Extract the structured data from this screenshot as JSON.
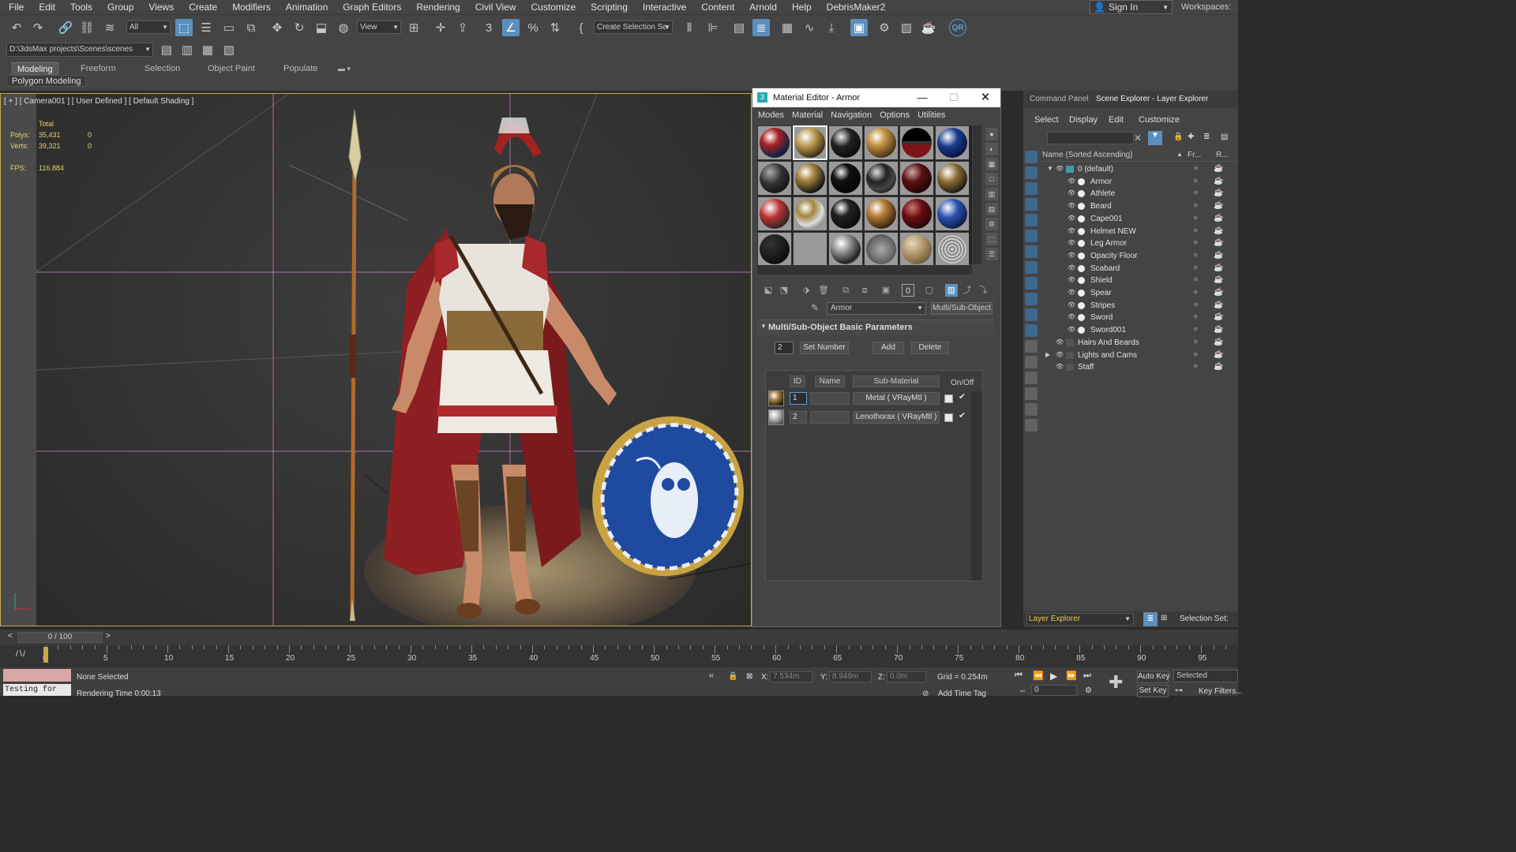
{
  "menu": [
    "File",
    "Edit",
    "Tools",
    "Group",
    "Views",
    "Create",
    "Modifiers",
    "Animation",
    "Graph Editors",
    "Rendering",
    "Civil View",
    "Customize",
    "Scripting",
    "Interactive",
    "Content",
    "Arnold",
    "Help",
    "DebrisMaker2"
  ],
  "signin": {
    "label": "Sign In"
  },
  "workspaces": {
    "label": "Workspaces:"
  },
  "toolbar": {
    "filter_dd": "All",
    "view_dd": "View",
    "selection_set_dd": "Create Selection Se",
    "snap_3": "3",
    "qr": "QR"
  },
  "project_path": "D:\\3dsMax projects\\Scenes\\scenes",
  "ribbon": {
    "tabs": [
      "Modeling",
      "Freeform",
      "Selection",
      "Object Paint",
      "Populate"
    ],
    "active": "Modeling",
    "sub": "Polygon Modeling"
  },
  "viewport": {
    "label": "[ + ] [ Camera001 ] [ User Defined ] [ Default Shading ]",
    "stats": {
      "total": "Total",
      "polys_label": "Polys:",
      "polys": "35,431",
      "polys_sel": "0",
      "verts_label": "Verts:",
      "verts": "39,321",
      "verts_sel": "0",
      "fps_label": "FPS:",
      "fps": "116.884"
    }
  },
  "material_editor": {
    "title": "Material Editor - Armor",
    "menu": [
      "Modes",
      "Material",
      "Navigation",
      "Options",
      "Utilities"
    ],
    "material_name": "Armor",
    "material_type": "Multi/Sub-Object",
    "rollout": "Multi/Sub-Object Basic Parameters",
    "set_number_value": "2",
    "set_number": "Set Number",
    "add": "Add",
    "delete": "Delete",
    "headers": {
      "id": "ID",
      "name": "Name",
      "sub": "Sub-Material",
      "onoff": "On/Off"
    },
    "rows": [
      {
        "id": "1",
        "sub": "Metal ( VRayMtl )"
      },
      {
        "id": "2",
        "sub": "Lenothorax ( VRayMtl )"
      }
    ]
  },
  "right_panel": {
    "tabs": [
      "Command Panel",
      "Scene Explorer - Layer Explorer"
    ],
    "menu": [
      "Select",
      "Display",
      "Edit",
      "Customize"
    ],
    "header": {
      "name": "Name (Sorted Ascending)",
      "fr": "Fr...",
      "r": "R..."
    },
    "root": "0 (default)",
    "children": [
      "Armor",
      "Athlete",
      "Beard",
      "Cape001",
      "Helmet NEW",
      "Leg Armor",
      "Opacity Floor",
      "Scabard",
      "Shield",
      "Spear",
      "Stripes",
      "Sword",
      "Sword001"
    ],
    "layers": [
      "Hairs And Beards",
      "Lights and Cams",
      "Staff"
    ],
    "explorer_dd": "Layer Explorer",
    "selection_set": "Selection Set:"
  },
  "timeline": {
    "frame": "0 / 100",
    "ticks": [
      "0",
      "5",
      "10",
      "15",
      "20",
      "25",
      "30",
      "35",
      "40",
      "45",
      "50",
      "55",
      "60",
      "65",
      "70",
      "75",
      "80",
      "85",
      "90",
      "95"
    ]
  },
  "status": {
    "maxscript": "Testing for ",
    "selected": "None Selected",
    "render_time": "Rendering Time 0:00:13",
    "x_label": "X:",
    "x": "7.534m",
    "y_label": "Y:",
    "y": "8.949m",
    "z_label": "Z:",
    "z": "0.0m",
    "grid": "Grid = 0.254m",
    "add_time_tag": "Add Time Tag",
    "auto_key": "Auto Key",
    "selected_dd": "Selected",
    "set_key": "Set Key",
    "key_filters": "Key Filters...",
    "frame": "0"
  }
}
